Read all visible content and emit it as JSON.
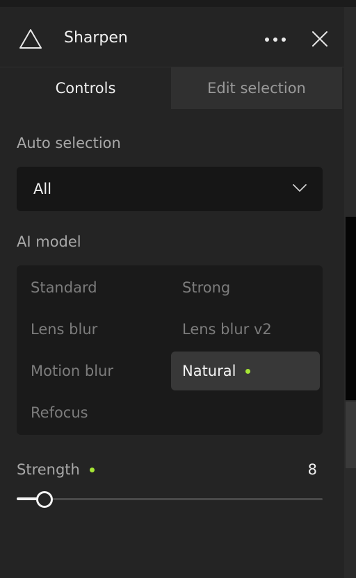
{
  "header": {
    "title": "Sharpen",
    "app_icon": "triangle-icon",
    "more_icon": "more-horizontal-icon",
    "close_icon": "close-icon"
  },
  "tabs": [
    {
      "label": "Controls",
      "active": true
    },
    {
      "label": "Edit selection",
      "active": false
    }
  ],
  "auto_selection": {
    "label": "Auto selection",
    "value": "All",
    "icon": "chevron-down-icon"
  },
  "ai_model": {
    "label": "AI model",
    "options": [
      {
        "label": "Standard",
        "selected": false
      },
      {
        "label": "Strong",
        "selected": false
      },
      {
        "label": "Lens blur",
        "selected": false
      },
      {
        "label": "Lens blur v2",
        "selected": false
      },
      {
        "label": "Motion blur",
        "selected": false
      },
      {
        "label": "Natural",
        "selected": true
      },
      {
        "label": "Refocus",
        "selected": false
      }
    ]
  },
  "strength": {
    "label": "Strength",
    "value": "8",
    "level": 0.09
  },
  "colors": {
    "accent_dot": "#a6e635",
    "panel_bg": "#242424",
    "text_primary": "#f0f0f0"
  }
}
